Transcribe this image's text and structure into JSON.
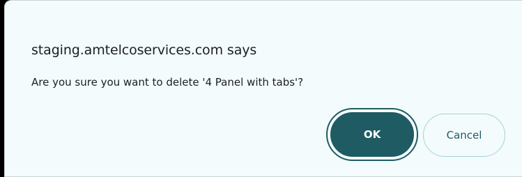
{
  "dialog": {
    "title": "staging.amtelcoservices.com says",
    "message": "Are you sure you want to delete '4 Panel with tabs'?",
    "ok_label": "OK",
    "cancel_label": "Cancel"
  },
  "colors": {
    "dialog_background": "#f4fbfc",
    "primary_button": "#1e5b62",
    "primary_text": "#ffffff",
    "secondary_border": "#9fd4da",
    "secondary_text": "#1e5b62",
    "text": "#1b1f20"
  }
}
